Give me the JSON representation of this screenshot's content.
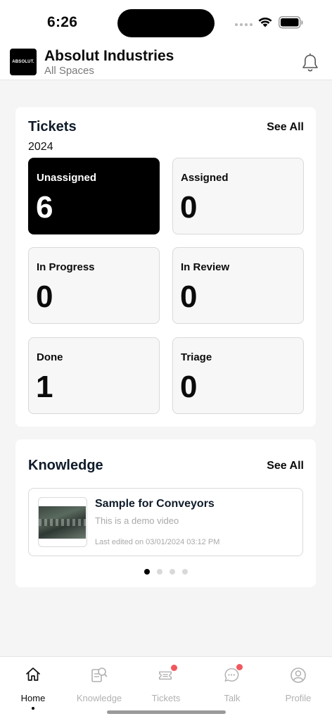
{
  "status_bar": {
    "time": "6:26"
  },
  "header": {
    "logo_text": "ABSOLUT.",
    "org_name": "Absolut Industries",
    "space": "All Spaces"
  },
  "tickets": {
    "title": "Tickets",
    "see_all": "See All",
    "year": "2024",
    "tiles": [
      {
        "label": "Unassigned",
        "count": "6"
      },
      {
        "label": "Assigned",
        "count": "0"
      },
      {
        "label": "In Progress",
        "count": "0"
      },
      {
        "label": "In Review",
        "count": "0"
      },
      {
        "label": "Done",
        "count": "1"
      },
      {
        "label": "Triage",
        "count": "0"
      }
    ]
  },
  "knowledge": {
    "title": "Knowledge",
    "see_all": "See All",
    "item": {
      "title": "Sample for Conveyors",
      "description": "This is a demo video",
      "edited": "Last edited on 03/01/2024 03:12 PM"
    },
    "pager_active_index": 0,
    "pager_count": 4
  },
  "bottom_nav": {
    "items": [
      {
        "label": "Home",
        "icon": "home-icon"
      },
      {
        "label": "Knowledge",
        "icon": "knowledge-icon"
      },
      {
        "label": "Tickets",
        "icon": "tickets-icon"
      },
      {
        "label": "Talk",
        "icon": "talk-icon"
      },
      {
        "label": "Profile",
        "icon": "profile-icon"
      }
    ],
    "active_index": 0
  },
  "colors": {
    "accent": "#000000",
    "badge": "#f0585e",
    "muted": "#b1b1b1",
    "background": "#f4f5f4"
  }
}
